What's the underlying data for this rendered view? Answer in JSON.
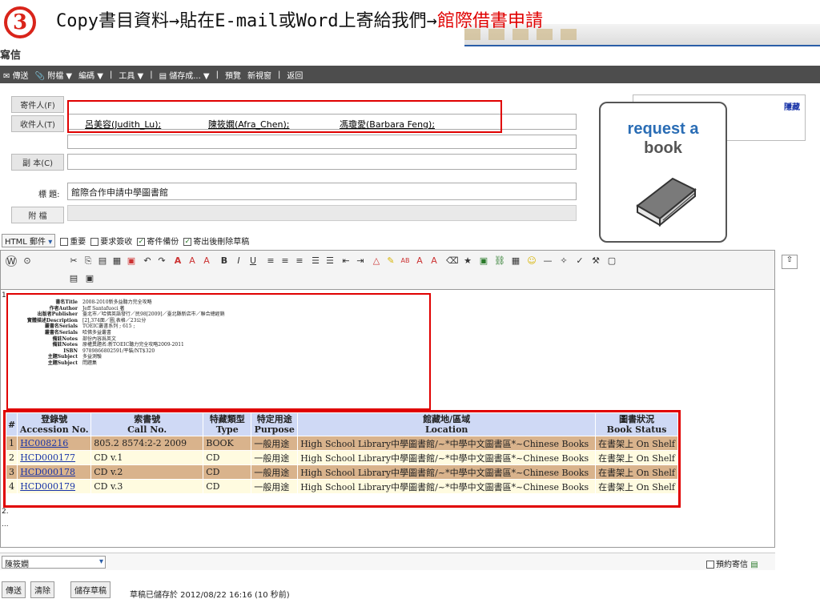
{
  "slide": {
    "step_number": "3",
    "title_part1": "Copy書目資料→貼在E-mail或Word上寄給我們→",
    "title_part2": "館際借書申請"
  },
  "compose": {
    "heading": "寫信",
    "toolbar": [
      "傳送",
      "附檔 ▼",
      "編碼 ▼",
      "|",
      "工具 ▼",
      "|",
      "儲存成... ▼",
      "|",
      "預覽",
      "新視窗",
      "|",
      "返回"
    ],
    "sender_label": "寄件人(F)",
    "to_label": "收件人(T)",
    "recipients": [
      "呂美容(Judith_Lu);",
      "陳筱嫻(Afra_Chen);",
      "馮瓊愛(Barbara Feng);"
    ],
    "cc_label": "副 本(C)",
    "subject_label": "標 題:",
    "subject_value": "館際合作申請中學圖書館",
    "attach_label": "附 檔",
    "address_book_hide": "隱藏",
    "format_select": "HTML 郵件",
    "options": [
      {
        "label": "重要",
        "checked": false
      },
      {
        "label": "要求簽收",
        "checked": false
      },
      {
        "label": "寄件備份",
        "checked": true
      },
      {
        "label": "寄出後刪除草稿",
        "checked": true
      }
    ]
  },
  "request_card": {
    "line1": "request a",
    "line2": "book"
  },
  "record": {
    "list_marker": "1.",
    "fields": [
      {
        "key": "書名Title",
        "value": "2008-2010新多益聽力完全攻略"
      },
      {
        "key": "作者Author",
        "value": "Jeff Santafuoci 著"
      },
      {
        "key": "出版者Publisher",
        "value": "臺北市／哈佛英語發行／民98[2009]／臺北縣新店市／聯合總經銷"
      },
      {
        "key": "實體描述Description",
        "value": "[2],374面／圖,表格／23公分"
      },
      {
        "key": "叢書名Serials",
        "value": "TOEIC叢書系列 ; 615 ;"
      },
      {
        "key": "叢書名Serials",
        "value": "哈佛多益叢書"
      },
      {
        "key": "備註Notes",
        "value": "部份內容爲英文"
      },
      {
        "key": "備註Notes",
        "value": "原權異題名:新TOEIC聽力完全攻略2009-2011"
      },
      {
        "key": "ISBN",
        "value": "9789866802591/平裝/NT$320"
      },
      {
        "key": "主題Subject",
        "value": "多益測驗"
      },
      {
        "key": "主題Subject",
        "value": "問題集"
      }
    ]
  },
  "holdings": {
    "headers": {
      "num": "#",
      "accession": [
        "登錄號",
        "Accession No."
      ],
      "call": [
        "索書號",
        "Call No."
      ],
      "type": [
        "特藏類型",
        "Type"
      ],
      "purpose": [
        "特定用途",
        "Purpose"
      ],
      "location": [
        "館藏地/區域",
        "Location"
      ],
      "status": [
        "圖書狀況",
        "Book Status"
      ]
    },
    "rows": [
      {
        "num": "1",
        "accession": "HC008216",
        "call": "805.2 8574:2-2 2009",
        "type": "BOOK",
        "purpose": "一般用途",
        "location": "High School Library中學圖書館/~*中學中文圖書區*~Chinese Books",
        "status": "在書架上 On Shelf"
      },
      {
        "num": "2",
        "accession": "HCD000177",
        "call": "CD v.1",
        "type": "CD",
        "purpose": "一般用途",
        "location": "High School Library中學圖書館/~*中學中文圖書區*~Chinese Books",
        "status": "在書架上 On Shelf"
      },
      {
        "num": "3",
        "accession": "HCD000178",
        "call": "CD v.2",
        "type": "CD",
        "purpose": "一般用途",
        "location": "High School Library中學圖書館/~*中學中文圖書區*~Chinese Books",
        "status": "在書架上 On Shelf"
      },
      {
        "num": "4",
        "accession": "HCD000179",
        "call": "CD v.3",
        "type": "CD",
        "purpose": "一般用途",
        "location": "High School Library中學圖書館/~*中學中文圖書區*~Chinese Books",
        "status": "在書架上 On Shelf"
      }
    ]
  },
  "footer": {
    "marker2": "2.",
    "ellipsis": "...",
    "signature_select": "陳筱嫻",
    "schedule_label": "預約寄信",
    "send": "傳送",
    "clear": "清除",
    "save_draft": "儲存草稿",
    "draft_status": "草稿已儲存於 2012/08/22 16:16 (10 秒前)"
  },
  "colors": {
    "highlight_red": "#e00000",
    "header_blue": "#cfd9f5",
    "row_tan": "#d9b38c",
    "row_cream": "#fffbe0"
  }
}
